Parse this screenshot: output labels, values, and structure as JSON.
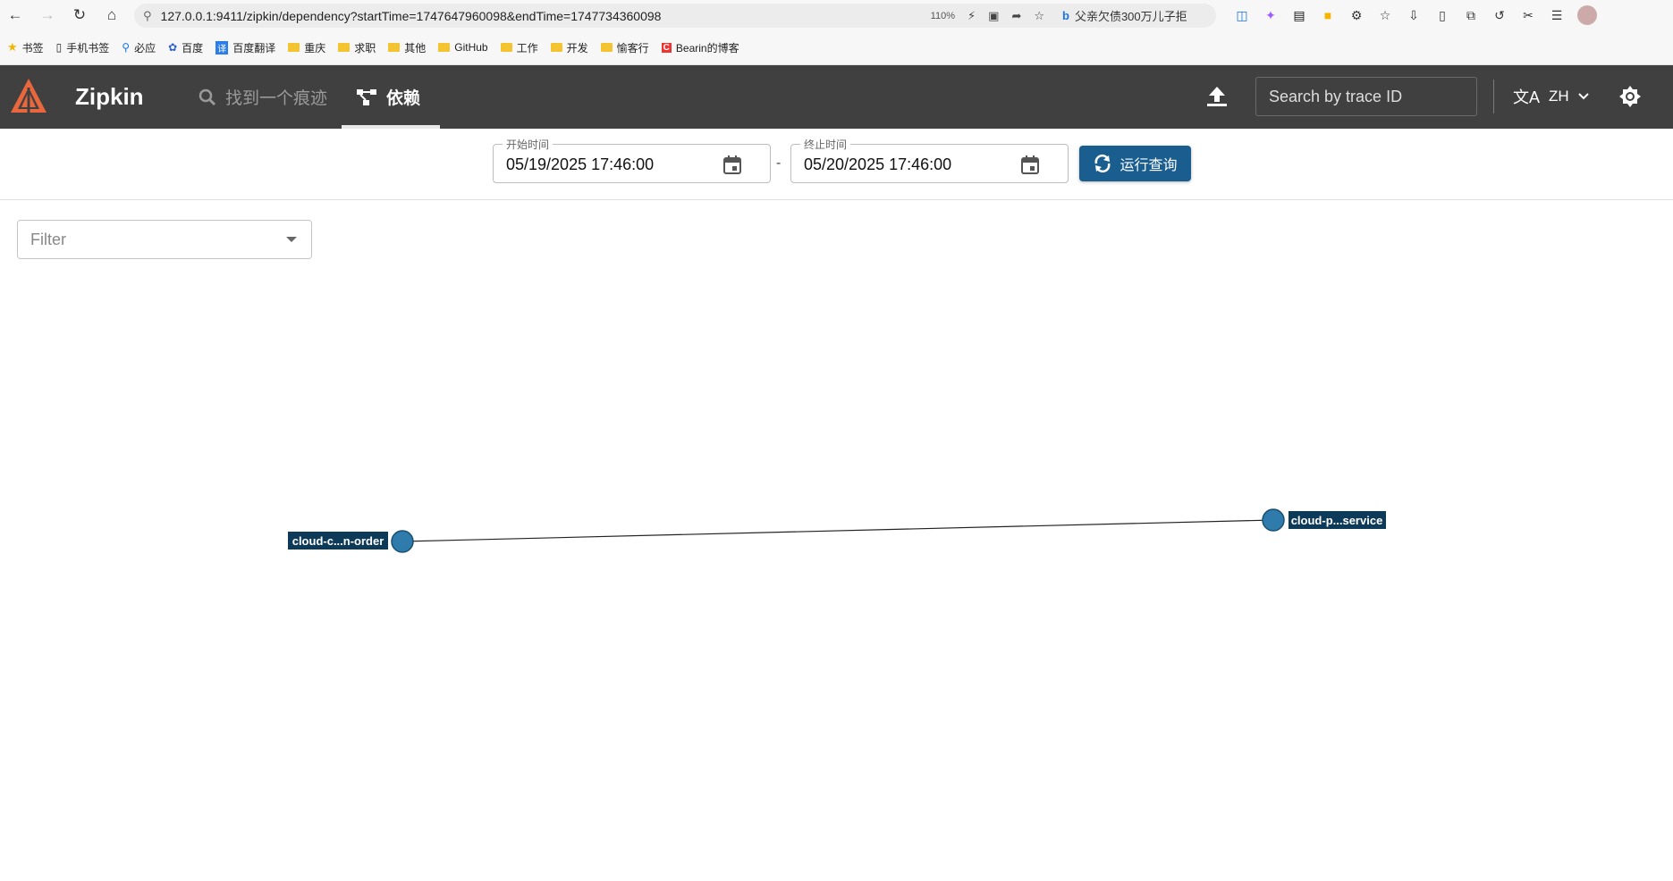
{
  "browser": {
    "url": "127.0.0.1:9411/zipkin/dependency?startTime=1747647960098&endTime=1747734360098",
    "zoom": "110%",
    "search_suggestion": "父亲欠债300万儿子拒",
    "bookmarks": [
      {
        "label": "书签",
        "icon": "star-icon"
      },
      {
        "label": "手机书签",
        "icon": "phone-icon"
      },
      {
        "label": "必应",
        "icon": "search-icon"
      },
      {
        "label": "百度",
        "icon": "baidu-icon"
      },
      {
        "label": "百度翻译",
        "icon": "translate-icon"
      },
      {
        "label": "重庆",
        "icon": "folder-icon"
      },
      {
        "label": "求职",
        "icon": "folder-icon"
      },
      {
        "label": "其他",
        "icon": "folder-icon"
      },
      {
        "label": "GitHub",
        "icon": "folder-icon"
      },
      {
        "label": "工作",
        "icon": "folder-icon"
      },
      {
        "label": "开发",
        "icon": "folder-icon"
      },
      {
        "label": "愉客行",
        "icon": "folder-icon"
      },
      {
        "label": "Bearin的博客",
        "icon": "csdn-icon"
      }
    ]
  },
  "header": {
    "app_title": "Zipkin",
    "find_trace_label": "找到一个痕迹",
    "dependencies_label": "依赖",
    "trace_search_placeholder": "Search by trace ID",
    "language": "ZH",
    "colors": {
      "header_bg": "#404040",
      "logo": "#e8673c"
    }
  },
  "query": {
    "start_label": "开始时间",
    "start_value": "05/19/2025 17:46:00",
    "separator": "-",
    "end_label": "终止时间",
    "end_value": "05/20/2025 17:46:00",
    "run_label": "运行查询",
    "run_color": "#1a5d8f"
  },
  "filter": {
    "placeholder": "Filter"
  },
  "graph": {
    "nodes": [
      {
        "id": "order",
        "label": "cloud-c...n-order"
      },
      {
        "id": "payment",
        "label": "cloud-p...service"
      }
    ],
    "edges": [
      {
        "from": "order",
        "to": "payment"
      }
    ],
    "node_color": "#2f7bab"
  }
}
